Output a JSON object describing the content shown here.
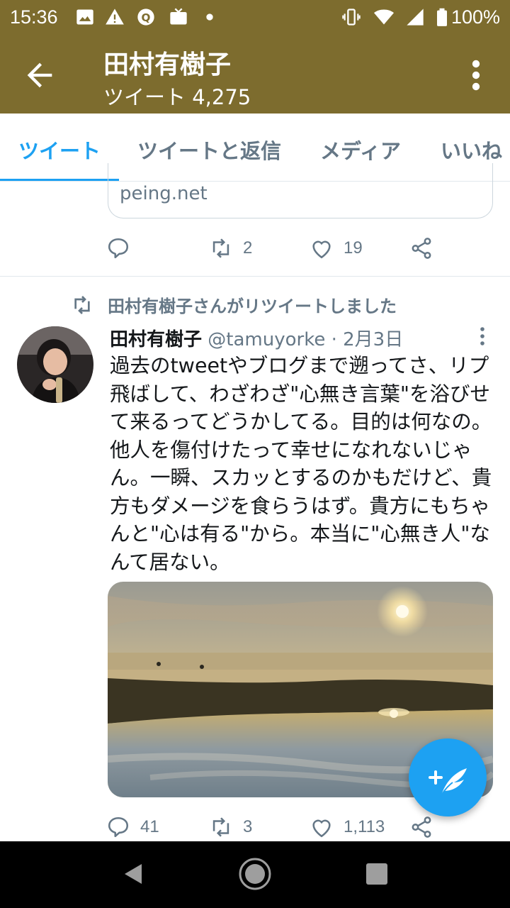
{
  "status_bar": {
    "time": "15:36",
    "battery": "100%",
    "icons": [
      "image-icon",
      "alert-icon",
      "chat-bubble-icon",
      "tv-icon",
      "dot-icon",
      "vibrate-icon",
      "wifi-icon",
      "signal-icon",
      "battery-icon"
    ]
  },
  "header": {
    "title": "田村有樹子",
    "subtitle": "ツイート 4,275"
  },
  "tabs": [
    {
      "label": "ツイート",
      "active": true
    },
    {
      "label": "ツイートと返信",
      "active": false
    },
    {
      "label": "メディア",
      "active": false
    },
    {
      "label": "いいね",
      "active": false
    }
  ],
  "previous_tweet": {
    "card_domain": "peing.net",
    "retweets": "2",
    "likes": "19"
  },
  "tweet": {
    "retweeted_by": "田村有樹子さんがリツイートしました",
    "author_name": "田村有樹子",
    "handle": "@tamuyorke",
    "separator": "·",
    "date": "2月3日",
    "text": "過去のtweetやブログまで遡ってさ、リプ飛ばして、わざわざ\"心無き言葉\"を浴びせて来るってどうかしてる。目的は何なの。他人を傷付けたって幸せになれないじゃん。一瞬、スカッとするのかもだけど、貴方もダメージを食らうはず。貴方にもちゃんと\"心は有る\"から。本当に\"心無き人\"なんて居ない。",
    "replies": "41",
    "retweets": "3",
    "likes": "1,113"
  },
  "colors": {
    "header_bg": "#7d6c2e",
    "accent": "#1da1f2",
    "muted": "#657786"
  }
}
